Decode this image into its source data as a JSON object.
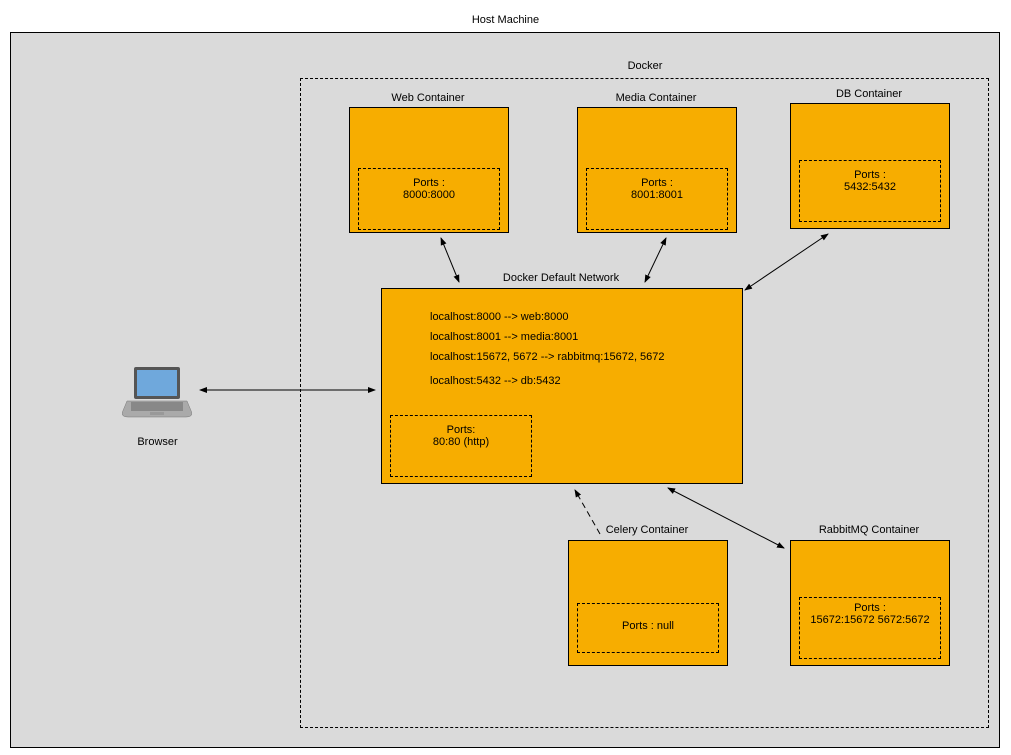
{
  "diagram": {
    "host_label": "Host Machine",
    "docker_label": "Docker",
    "browser_label": "Browser",
    "network_title": "Docker Default Network",
    "network_mappings": [
      "localhost:8000 --> web:8000",
      "localhost:8001 --> media:8001",
      "localhost:15672, 5672 --> rabbitmq:15672, 5672",
      "localhost:5432 --> db:5432"
    ],
    "network_ports_label": "Ports:",
    "network_ports_value": "80:80 (http)",
    "containers": {
      "web": {
        "title": "Web Container",
        "ports_label": "Ports :",
        "ports_value": "8000:8000"
      },
      "media": {
        "title": "Media Container",
        "ports_label": "Ports :",
        "ports_value": "8001:8001"
      },
      "db": {
        "title": "DB Container",
        "ports_label": "Ports :",
        "ports_value": "5432:5432"
      },
      "celery": {
        "title": "Celery Container",
        "ports_label": "Ports : null",
        "ports_value": ""
      },
      "rabbitmq": {
        "title": "RabbitMQ Container",
        "ports_label": "Ports :",
        "ports_value": "15672:15672\n5672:5672"
      }
    }
  }
}
